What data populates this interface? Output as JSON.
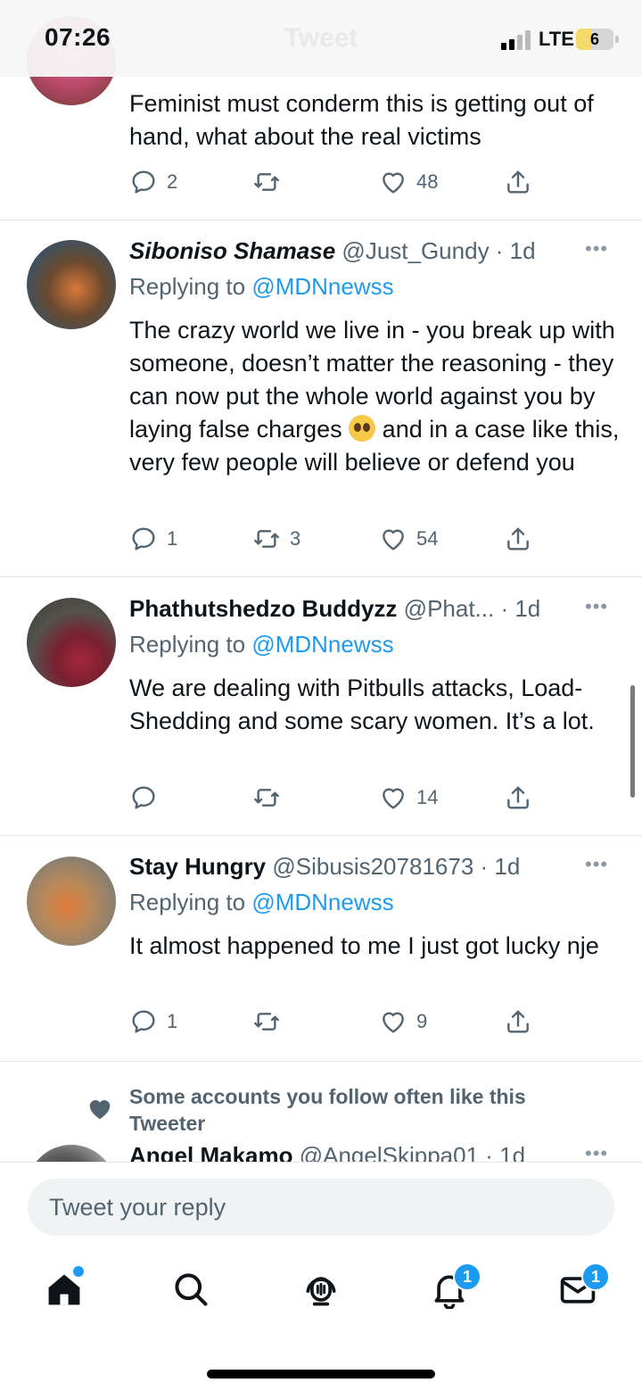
{
  "status_bar": {
    "time": "07:26",
    "network": "LTE",
    "battery": "6",
    "faded_title": "Tweet"
  },
  "tweets": [
    {
      "body": "Feminist must conderm this is getting out of hand, what about the real victims",
      "replies": "2",
      "retweets": "",
      "likes": "48"
    },
    {
      "name": "Siboniso Shamase",
      "handle": "@Just_Gundy",
      "time": "1d",
      "replying_prefix": "Replying to",
      "replying_to": "@MDNnewss",
      "body_1": "The crazy world we live in - you break up with someone, doesn’t matter the reasoning - they can now put the whole world against you by laying false charges",
      "body_2": "and in a case like this, very few people will believe or defend you",
      "emoji": "pleading-face-emoji",
      "replies": "1",
      "retweets": "3",
      "likes": "54"
    },
    {
      "name": "Phathutshedzo Buddyzz",
      "handle": "@Phat...",
      "time": "1d",
      "replying_prefix": "Replying to",
      "replying_to": "@MDNnewss",
      "body": "We are dealing with Pitbulls attacks, Load-Shedding and some scary women. It’s a lot.",
      "replies": "",
      "retweets": "",
      "likes": "14"
    },
    {
      "name": "Stay Hungry",
      "handle": "@Sibusis20781673",
      "time": "1d",
      "replying_prefix": "Replying to",
      "replying_to": "@MDNnewss",
      "body": "It almost happened to me I just got lucky nje",
      "replies": "1",
      "retweets": "",
      "likes": "9"
    },
    {
      "social_context": "Some accounts you follow often like this Tweeter",
      "name": "Angel Makamo",
      "handle": "@AngelSkippa01",
      "time": "1d"
    }
  ],
  "reply": {
    "placeholder": "Tweet your reply"
  },
  "tabs": [
    {
      "name": "home",
      "icon": "home-icon"
    },
    {
      "name": "search",
      "icon": "search-icon"
    },
    {
      "name": "spaces",
      "icon": "spaces-icon"
    },
    {
      "name": "notifications",
      "icon": "bell-icon",
      "badge": "1"
    },
    {
      "name": "messages",
      "icon": "mail-icon",
      "badge": "1"
    }
  ],
  "colors": {
    "accent": "#1d9bf0",
    "text": "#0f1419",
    "secondary": "#536471"
  }
}
